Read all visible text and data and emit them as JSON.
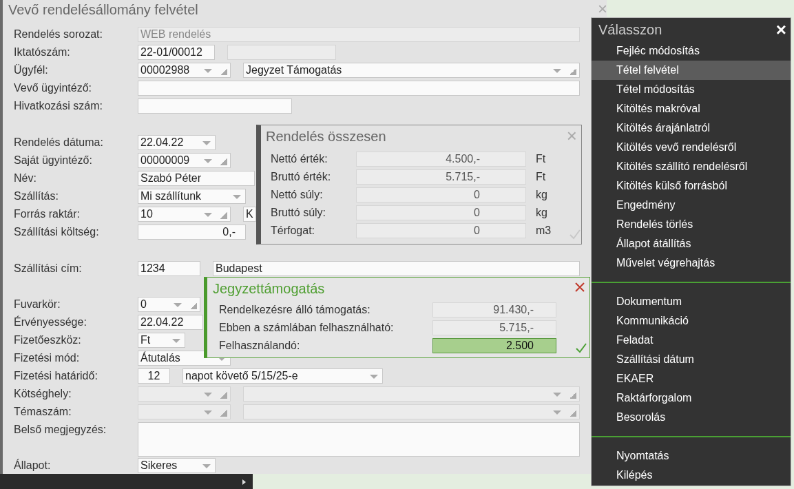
{
  "form": {
    "title": "Vevő rendelésállomány felvétel",
    "close": "×",
    "rows": [
      {
        "label": "Rendelés sorozat:",
        "fields": [
          {
            "kind": "text",
            "value": "WEB rendelés",
            "disabled": true
          }
        ]
      },
      {
        "label": "Iktatószám:",
        "fields": [
          {
            "kind": "text",
            "value": "22-01/00012",
            "disabled": false
          },
          {
            "kind": "text",
            "disabled": true
          }
        ]
      },
      {
        "label": "Ügyfél:",
        "fields": [
          {
            "kind": "lookup",
            "value": "00002988",
            "disabled": false
          },
          {
            "kind": "lookup",
            "value": "Jegyzet Támogatás",
            "disabled": false
          }
        ]
      },
      {
        "label": "Vevő ügyintéző:",
        "fields": [
          {
            "kind": "text",
            "disabled": false
          }
        ]
      },
      {
        "label": "Hivatkozási szám:",
        "fields": [
          {
            "kind": "text",
            "disabled": false
          }
        ]
      },
      {
        "label": "Rendelés dátuma:",
        "fields": [
          {
            "kind": "select",
            "value": "22.04.22",
            "disabled": false
          }
        ]
      },
      {
        "label": "Saját ügyintéző:",
        "fields": [
          {
            "kind": "lookup",
            "value": "00000009",
            "disabled": false
          }
        ]
      },
      {
        "label": "Név:",
        "fields": [
          {
            "kind": "text",
            "value": "Szabó Péter",
            "disabled": false
          }
        ]
      },
      {
        "label": "Szállítás:",
        "fields": [
          {
            "kind": "select",
            "value": "Mi szállítunk",
            "disabled": false
          }
        ]
      },
      {
        "label": "Forrás raktár:",
        "fields": [
          {
            "kind": "lookup",
            "value": "10",
            "disabled": false
          },
          {
            "kind": "text",
            "value": "K",
            "disabled": false
          }
        ]
      },
      {
        "label": "Szállítási költség:",
        "fields": [
          {
            "kind": "amount",
            "value": "0,-",
            "disabled": false
          }
        ]
      },
      {
        "label": "Szállítási cím:",
        "fields": [
          {
            "kind": "text",
            "value": "1234",
            "disabled": false
          },
          {
            "kind": "text",
            "value": "Budapest",
            "disabled": false
          }
        ]
      },
      {
        "label": "Fuvarkör:",
        "fields": [
          {
            "kind": "lookup",
            "value": "0",
            "disabled": false
          }
        ]
      },
      {
        "label": "Érvényessége:",
        "fields": [
          {
            "kind": "text",
            "value": "22.04.22",
            "disabled": false
          }
        ]
      },
      {
        "label": "Fizetőeszköz:",
        "fields": [
          {
            "kind": "select",
            "value": "Ft",
            "disabled": false
          }
        ]
      },
      {
        "label": "Fizetési mód:",
        "fields": [
          {
            "kind": "select",
            "value": "Átutalás",
            "disabled": false
          }
        ]
      },
      {
        "label": "Fizetési határidő:",
        "fields": [
          {
            "kind": "count",
            "value": "12",
            "disabled": false
          },
          {
            "kind": "select",
            "value": "napot követő 5/15/25-e",
            "disabled": false
          }
        ]
      },
      {
        "label": "Kötséghely:",
        "fields": [
          {
            "kind": "lookup",
            "disabled": true
          },
          {
            "kind": "lookup",
            "disabled": true
          }
        ]
      },
      {
        "label": "Témaszám:",
        "fields": [
          {
            "kind": "lookup",
            "disabled": true
          },
          {
            "kind": "lookup",
            "disabled": true
          }
        ]
      },
      {
        "label": "Belső megjegyzés:",
        "fields": [
          {
            "kind": "textarea",
            "disabled": false
          }
        ]
      },
      {
        "label": "Állapot:",
        "fields": [
          {
            "kind": "select",
            "value": "Sikeres",
            "disabled": false
          }
        ]
      }
    ]
  },
  "summary": {
    "title": "Rendelés összesen",
    "close": "×",
    "rows": [
      {
        "label": "Nettó érték:",
        "value": "4.500,-",
        "unit": "Ft"
      },
      {
        "label": "Bruttó érték:",
        "value": "5.715,-",
        "unit": "Ft"
      },
      {
        "label": "Nettó súly:",
        "value": "0",
        "unit": "kg"
      },
      {
        "label": "Bruttó súly:",
        "value": "0",
        "unit": "kg"
      },
      {
        "label": "Térfogat:",
        "value": "0",
        "unit": "m3"
      }
    ]
  },
  "support": {
    "title": "Jegyzettámogatás",
    "rows": [
      {
        "label": "Rendelkezésre álló támogatás:",
        "value": "91.430,-",
        "active": false
      },
      {
        "label": "Ebben a számlában felhasználható:",
        "value": "5.715,-",
        "active": false
      },
      {
        "label": "Felhasználandó:",
        "value": "2.500",
        "active": true
      }
    ]
  },
  "menu": {
    "title": "Válasszon",
    "close": "×",
    "groups": [
      {
        "items": [
          {
            "label": "Fejléc módosítás",
            "selected": false
          },
          {
            "label": "Tétel felvétel",
            "selected": true
          },
          {
            "label": "Tétel módosítás",
            "selected": false
          },
          {
            "label": "Kitöltés makróval",
            "selected": false
          },
          {
            "label": "Kitöltés árajánlatról",
            "selected": false
          },
          {
            "label": "Kitöltés vevő rendelésről",
            "selected": false
          },
          {
            "label": "Kitöltés szállító rendelésről",
            "selected": false
          },
          {
            "label": "Kitöltés külső forrásból",
            "selected": false
          },
          {
            "label": "Engedmény",
            "selected": false
          },
          {
            "label": "Rendelés törlés",
            "selected": false
          },
          {
            "label": "Állapot átállítás",
            "selected": false
          },
          {
            "label": "Művelet végrehajtás",
            "selected": false
          }
        ]
      },
      {
        "items": [
          {
            "label": "Dokumentum",
            "selected": false
          },
          {
            "label": "Kommunikáció",
            "selected": false
          },
          {
            "label": "Feladat",
            "selected": false
          },
          {
            "label": "Szállítási dátum",
            "selected": false
          },
          {
            "label": "EKAER",
            "selected": false
          },
          {
            "label": "Raktárforgalom",
            "selected": false
          },
          {
            "label": "Besorolás",
            "selected": false
          }
        ]
      },
      {
        "items": [
          {
            "label": "Nyomtatás",
            "selected": false
          },
          {
            "label": "Kilépés",
            "selected": false
          }
        ]
      }
    ]
  }
}
